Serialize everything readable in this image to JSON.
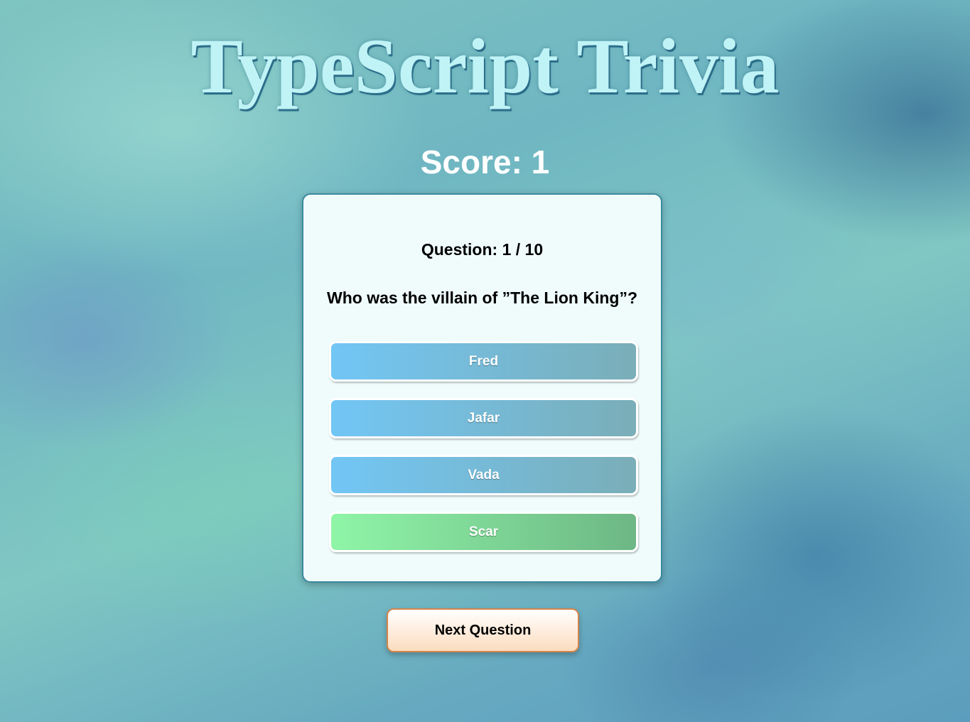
{
  "app": {
    "title": "TypeScript Trivia"
  },
  "score": {
    "label": "Score: 1"
  },
  "quiz": {
    "question_number": "Question: 1 / 10",
    "question_text": "Who was the villain of ”The Lion King”?",
    "answers": [
      {
        "label": "Fred",
        "status": "incorrect"
      },
      {
        "label": "Jafar",
        "status": "incorrect"
      },
      {
        "label": "Vada",
        "status": "incorrect"
      },
      {
        "label": "Scar",
        "status": "correct"
      }
    ]
  },
  "actions": {
    "next_label": "Next Question"
  },
  "colors": {
    "answer_gradient_start": "#72c6f5",
    "answer_gradient_end": "#7aaeb8",
    "correct_gradient_start": "#8ff5a7",
    "correct_gradient_end": "#6db785",
    "next_button_border": "#d4854b",
    "title_color": "#bff3f6"
  }
}
